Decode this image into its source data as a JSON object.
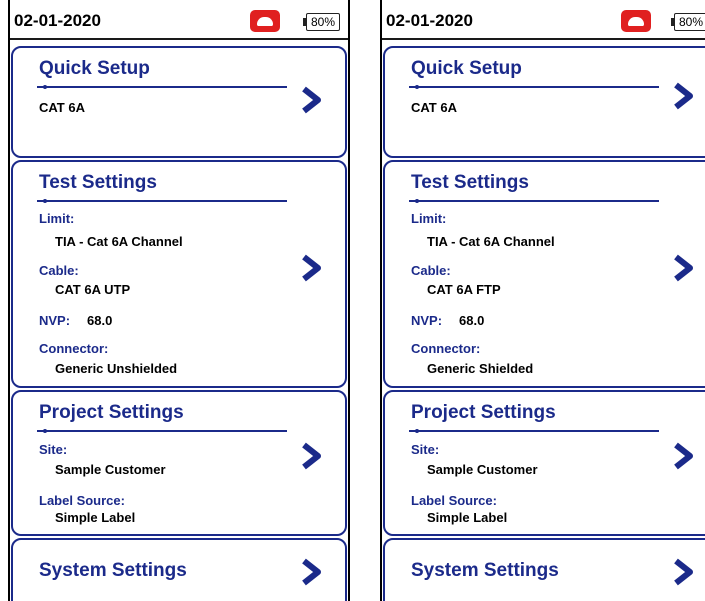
{
  "screens": [
    {
      "status": {
        "date": "02-01-2020",
        "battery": "80%",
        "call_icon": "phone-hangup-icon"
      },
      "quick_setup": {
        "title": "Quick Setup",
        "value": "CAT 6A"
      },
      "test_settings": {
        "title": "Test Settings",
        "limit_label": "Limit:",
        "limit_value": "TIA - Cat 6A Channel",
        "cable_label": "Cable:",
        "cable_value": "CAT 6A UTP",
        "nvp_label": "NVP:",
        "nvp_value": "68.0",
        "connector_label": "Connector:",
        "connector_value": "Generic Unshielded"
      },
      "project_settings": {
        "title": "Project Settings",
        "site_label": "Site:",
        "site_value": "Sample Customer",
        "label_source_label": "Label Source:",
        "label_source_value": "Simple Label"
      },
      "system_settings": {
        "title": "System Settings"
      }
    },
    {
      "status": {
        "date": "02-01-2020",
        "battery": "80%",
        "call_icon": "phone-hangup-icon"
      },
      "quick_setup": {
        "title": "Quick Setup",
        "value": "CAT 6A"
      },
      "test_settings": {
        "title": "Test Settings",
        "limit_label": "Limit:",
        "limit_value": "TIA - Cat 6A Channel",
        "cable_label": "Cable:",
        "cable_value": "CAT 6A FTP",
        "nvp_label": "NVP:",
        "nvp_value": "68.0",
        "connector_label": "Connector:",
        "connector_value": "Generic Shielded"
      },
      "project_settings": {
        "title": "Project Settings",
        "site_label": "Site:",
        "site_value": "Sample Customer",
        "label_source_label": "Label Source:",
        "label_source_value": "Simple Label"
      },
      "system_settings": {
        "title": "System Settings"
      }
    }
  ],
  "colors": {
    "accent": "#1b2a8a",
    "call": "#e02020",
    "text": "#000000"
  },
  "icons": {
    "chevron": "chevron-right-icon"
  }
}
